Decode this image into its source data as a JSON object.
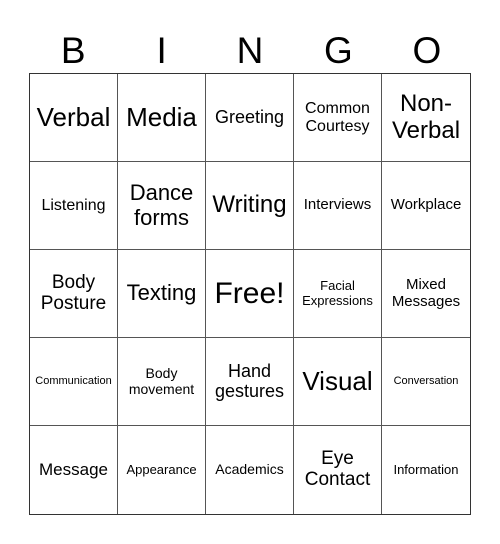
{
  "header": [
    "B",
    "I",
    "N",
    "G",
    "O"
  ],
  "cells": [
    "Verbal",
    "Media",
    "Greeting",
    "Common Courtesy",
    "Non-Verbal",
    "Listening",
    "Dance forms",
    "Writing",
    "Interviews",
    "Workplace",
    "Body Posture",
    "Texting",
    "Free!",
    "Facial Expressions",
    "Mixed Messages",
    "Communication",
    "Body movement",
    "Hand gestures",
    "Visual",
    "Conversation",
    "Message",
    "Appearance",
    "Academics",
    "Eye Contact",
    "Information"
  ]
}
